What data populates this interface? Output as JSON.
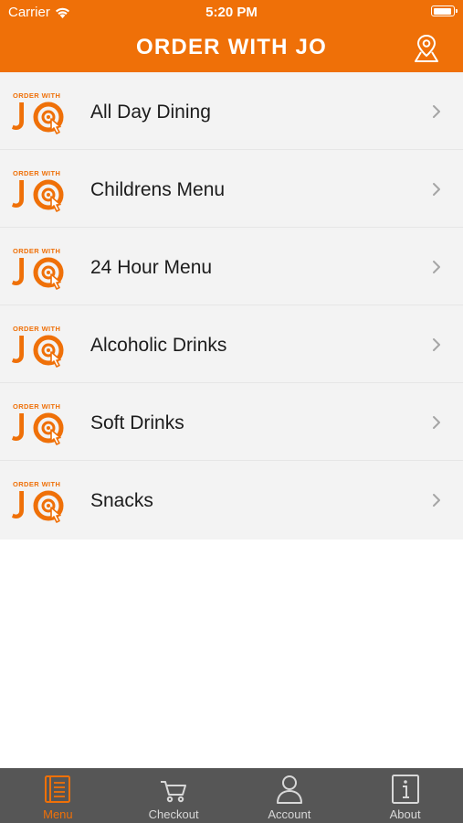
{
  "status_bar": {
    "carrier": "Carrier",
    "time": "5:20 PM"
  },
  "header": {
    "title": "ORDER WITH JO",
    "action_icon": "map-pin-icon"
  },
  "logo": {
    "small_text": "ORDER WITH",
    "big_text": "JO"
  },
  "menu": {
    "items": [
      {
        "label": "All Day Dining"
      },
      {
        "label": "Childrens Menu"
      },
      {
        "label": "24 Hour Menu"
      },
      {
        "label": "Alcoholic Drinks"
      },
      {
        "label": "Soft Drinks"
      },
      {
        "label": "Snacks"
      }
    ]
  },
  "tabs": [
    {
      "label": "Menu",
      "icon": "menu-book-icon",
      "active": true
    },
    {
      "label": "Checkout",
      "icon": "cart-icon",
      "active": false
    },
    {
      "label": "Account",
      "icon": "user-icon",
      "active": false
    },
    {
      "label": "About",
      "icon": "info-icon",
      "active": false
    }
  ],
  "colors": {
    "brand": "#ef7008",
    "tab_bar": "#565656",
    "list_bg": "#f3f3f3"
  }
}
